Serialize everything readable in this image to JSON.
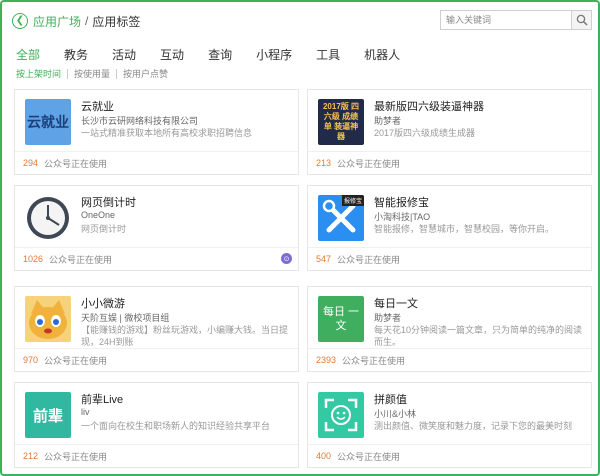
{
  "header": {
    "back_icon": "chevron-left-icon",
    "crumb_link": "应用广场",
    "crumb_sep": "/",
    "crumb_current": "应用标签"
  },
  "search": {
    "placeholder": "输入关键词",
    "icon": "search-icon"
  },
  "tabs": [
    {
      "label": "全部",
      "active": true
    },
    {
      "label": "教务"
    },
    {
      "label": "活动"
    },
    {
      "label": "互动"
    },
    {
      "label": "查询"
    },
    {
      "label": "小程序"
    },
    {
      "label": "工具"
    },
    {
      "label": "机器人"
    }
  ],
  "sorts": [
    "按上架时间",
    "按使用量",
    "按用户点赞"
  ],
  "usage_suffix": "公众号正在使用",
  "apps": [
    {
      "name": "云就业",
      "dev": "长沙市云研网络科技有限公司",
      "desc": "一站式精准获取本地所有高校求职招聘信息",
      "count": "294",
      "icon_text": "云就业",
      "icon_color": "#5fa3e6"
    },
    {
      "name": "最新版四六级装逼神器",
      "dev": "助梦者",
      "desc": "2017版四六级成绩生成器",
      "count": "213",
      "icon_text": "2017版 四六级 成绩单 装逼神器",
      "icon_color": "#222a4a"
    },
    {
      "name": "网页倒计时",
      "dev": "OneOne",
      "desc": "网页倒计时",
      "count": "1026",
      "icon_text": "",
      "icon_color": "#3f4654",
      "badge": "⊙"
    },
    {
      "name": "智能报修宝",
      "dev": "小淘科技|TAO",
      "desc": "智能报修，智慧城市，智慧校园，等你开启。",
      "count": "547",
      "icon_text": "报修宝",
      "icon_color": "#2a8ff0"
    },
    {
      "name": "小小微游",
      "dev": "天阶互娱 | 微校项目组",
      "desc": "【能赚钱的游戏】粉丝玩游戏，小编赚大钱。当日提现，24H到账",
      "count": "970",
      "icon_text": "",
      "icon_color": "#f0b23a"
    },
    {
      "name": "每日一文",
      "dev": "助梦者",
      "desc": "每天花10分钟阅读一篇文章，只为简单的纯净的阅读而生。",
      "count": "2393",
      "icon_text": "每日 一文",
      "icon_color": "#3fae5f"
    },
    {
      "name": "前辈Live",
      "dev": "liv",
      "desc": "一个面向在校生和职场新人的知识经验共享平台",
      "count": "212",
      "icon_text": "前辈",
      "icon_color": "#30b8a0"
    },
    {
      "name": "拼颜值",
      "dev": "小川&小林",
      "desc": "测出颜值、微笑度和魅力度，记录下您的最美时刻",
      "count": "400",
      "icon_text": "",
      "icon_color": "#33c9a3"
    }
  ]
}
